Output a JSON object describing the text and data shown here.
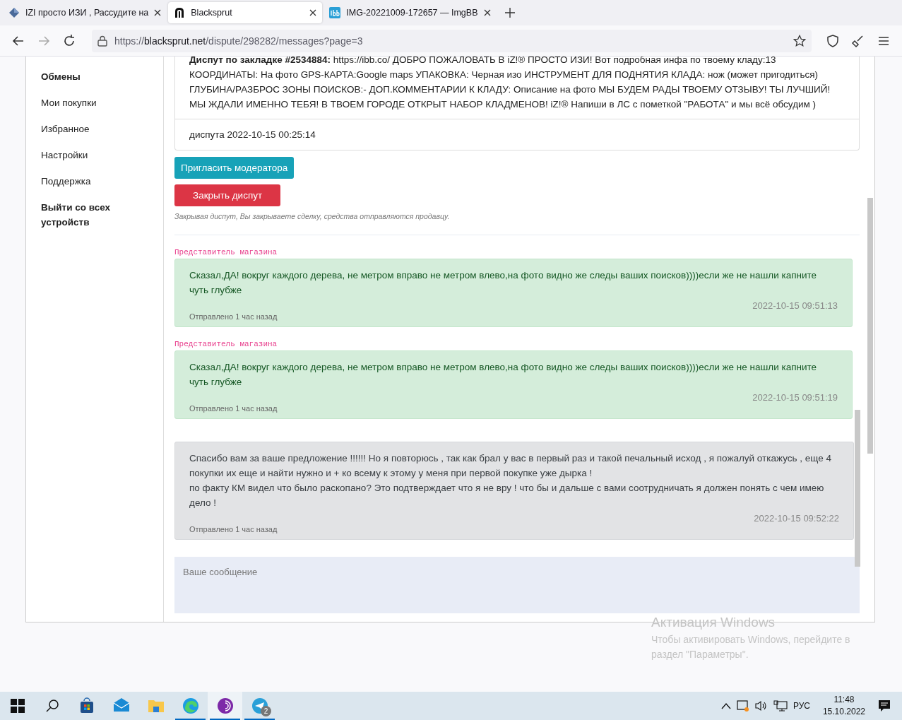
{
  "browser": {
    "tabs": [
      {
        "title": "IZI просто ИЗИ , Рассудите на",
        "selected": false
      },
      {
        "title": "Blacksprut",
        "selected": true
      },
      {
        "title": "IMG-20221009-172657 — ImgBB",
        "selected": false
      }
    ],
    "url": {
      "scheme": "https://",
      "host": "blacksprut.net",
      "path": "/dispute/298282/messages?page=3"
    }
  },
  "sidebar": {
    "items": [
      {
        "label": "Обмены",
        "bold": true
      },
      {
        "label": "Мои покупки",
        "bold": false
      },
      {
        "label": "Избранное",
        "bold": false
      },
      {
        "label": "Настройки",
        "bold": false
      },
      {
        "label": "Поддержка",
        "bold": false
      },
      {
        "label": "Выйти со всех устройств",
        "bold": true
      }
    ]
  },
  "dispute": {
    "description": "**Диспут по закладке #2534884:** https://ibb.co/ ДОБРО ПОЖАЛОВАТЬ В iZ!® ПРОСТО ИЗИ! Вот подробная инфа по твоему кладу:13 КООРДИНАТЫ: На фото GPS-КАРТА:Google maps УПАКОВКА: Черная изо ИНСТРУМЕНТ ДЛЯ ПОДНЯТИЯ КЛАДА: нож (может пригодиться) ГЛУБИНА/РАЗБРОС ЗОНЫ ПОИСКОВ:- ДОП.КОММЕНТАРИИ К КЛАДУ: Описание на фото МЫ БУДЕМ РАДЫ ТВОЕМУ ОТЗЫВУ! ТЫ ЛУЧШИЙ! МЫ ЖДАЛИ ИМЕННО ТЕБЯ! В ТВОЕМ ГОРОДЕ ОТКРЫТ НАБОР КЛАДМЕНОВ! iZ!® Напиши в ЛС с пометкой \"РАБОТА\" и мы всё обсудим )",
    "footer": "диспута 2022-10-15 00:25:14",
    "invite_button": "Пригласить модератора",
    "close_button": "Закрыть диспут",
    "close_note": "Закрывая диспут, Вы закрываете сделку, средства отправляются продавцу."
  },
  "messages": [
    {
      "kind": "shop",
      "author": "Представитель магазина",
      "text": "Сказал,ДА! вокруг каждого дерева, не метром вправо не метром влево,на фото видно же следы ваших поисков))))если же не нашли капните чуть глубже",
      "timestamp": "2022-10-15 09:51:13",
      "sent": "Отправлено 1 час назад"
    },
    {
      "kind": "shop",
      "author": "Представитель магазина",
      "text": "Сказал,ДА! вокруг каждого дерева, не метром вправо не метром влево,на фото видно же следы ваших поисков))))если же не нашли капните чуть глубже",
      "timestamp": "2022-10-15 09:51:19",
      "sent": "Отправлено 1 час назад"
    },
    {
      "kind": "buyer",
      "lines": [
        "Спасибо вам за ваше предложение !!!!!! Но я повторюсь , так как брал у вас в первый раз и такой печальный исход , я пожалуй откажусь , еще 4 покупки их еще и найти нужно и + ко всему к этому у меня при первой покупке уже дырка !",
        "по факту КМ видел что было раскопано? Это подтверждает что я не вру ! что бы и дальше с вами соотрудничать я должен понять с чем имею дело !"
      ],
      "timestamp": "2022-10-15 09:52:22",
      "sent": "Отправлено 1 час назад"
    }
  ],
  "composer": {
    "placeholder": "Ваше сообщение"
  },
  "activation": {
    "title": "Активация Windows",
    "text": "Чтобы активировать Windows, перейдите в раздел \"Параметры\"."
  },
  "taskbar": {
    "apps": [
      {
        "kind": "store",
        "running": false,
        "selected": false
      },
      {
        "kind": "mail",
        "running": false,
        "selected": false
      },
      {
        "kind": "folder",
        "running": false,
        "selected": false
      },
      {
        "kind": "edge",
        "running": true,
        "selected": false
      },
      {
        "kind": "tor",
        "running": true,
        "selected": true
      },
      {
        "kind": "telegram",
        "running": true,
        "selected": false,
        "badge": "2"
      }
    ],
    "language": "РУС",
    "time": "11:48",
    "date": "15.10.2022"
  }
}
